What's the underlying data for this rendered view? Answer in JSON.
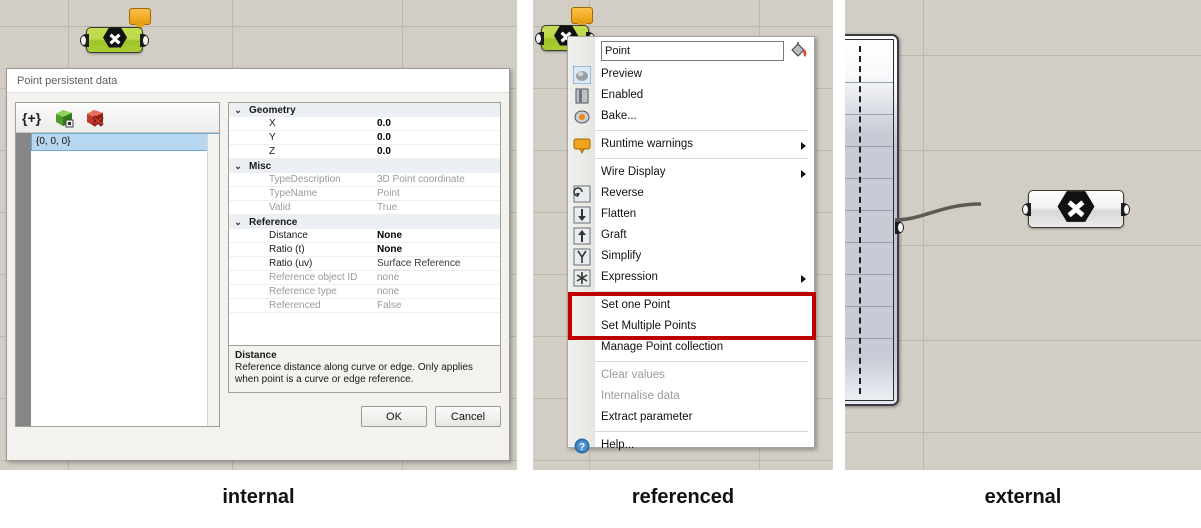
{
  "figure": {
    "captions": [
      {
        "key": "internal",
        "label": "internal"
      },
      {
        "key": "referenced",
        "label": "referenced"
      },
      {
        "key": "external",
        "label": "external"
      }
    ],
    "colors": {
      "canvas_background": "#d2cec5",
      "canvas_gridline": "#bcb8ae",
      "component_green": "#b9d646",
      "component_grey": "#ececec",
      "highlight_red": "#c00000",
      "selection_blue": "#b7d6ef",
      "balloon_orange": "#f2ab25"
    }
  },
  "panel_internal": {
    "component": {
      "name": "point-component",
      "icon": "hexagon-x-icon",
      "balloon": "warning-balloon-icon"
    },
    "dialog": {
      "title": "Point persistent data",
      "toolbar": [
        {
          "name": "insert-item-icon",
          "glyph": "{+}",
          "label": "{+}"
        },
        {
          "name": "add-green-box-icon",
          "glyph": "",
          "label": ""
        },
        {
          "name": "delete-red-box-icon",
          "glyph": "",
          "label": ""
        }
      ],
      "list": [
        {
          "index": "0",
          "value": "{0, 0, 0}"
        }
      ],
      "properties": [
        {
          "kind": "category",
          "name": "Geometry",
          "value": "",
          "chev": "⌄"
        },
        {
          "kind": "item",
          "name": "X",
          "value": "0.0",
          "style": "bold"
        },
        {
          "kind": "item",
          "name": "Y",
          "value": "0.0",
          "style": "bold"
        },
        {
          "kind": "item",
          "name": "Z",
          "value": "0.0",
          "style": "bold"
        },
        {
          "kind": "category",
          "name": "Misc",
          "value": "",
          "chev": "⌄"
        },
        {
          "kind": "item",
          "name": "TypeDescription",
          "value": "3D Point coordinate",
          "style": "dim"
        },
        {
          "kind": "item",
          "name": "TypeName",
          "value": "Point",
          "style": "dim"
        },
        {
          "kind": "item",
          "name": "Valid",
          "value": "True",
          "style": "dim"
        },
        {
          "kind": "category",
          "name": "Reference",
          "value": "",
          "chev": "⌄"
        },
        {
          "kind": "item",
          "name": "Distance",
          "value": "None",
          "style": "bold"
        },
        {
          "kind": "item",
          "name": "Ratio (t)",
          "value": "None",
          "style": "bold"
        },
        {
          "kind": "item",
          "name": "Ratio (uv)",
          "value": "Surface Reference",
          "style": "norm"
        },
        {
          "kind": "item",
          "name": "Reference object ID",
          "value": "none",
          "style": "dim"
        },
        {
          "kind": "item",
          "name": "Reference type",
          "value": "none",
          "style": "dim"
        },
        {
          "kind": "item",
          "name": "Referenced",
          "value": "False",
          "style": "dim"
        }
      ],
      "description": {
        "title": "Distance",
        "body": "Reference distance along curve or edge. Only applies when point is a curve or edge reference."
      },
      "buttons": [
        {
          "name": "ok-button",
          "label": "OK"
        },
        {
          "name": "cancel-button",
          "label": "Cancel"
        }
      ]
    }
  },
  "panel_referenced": {
    "component": {
      "name": "point-component",
      "icon": "hexagon-x-icon",
      "balloon": "warning-balloon-icon"
    },
    "menu": {
      "name_field": {
        "value": "Point",
        "placeholder": "Point"
      },
      "bucket_icon": "paint-bucket-icon",
      "items": [
        {
          "type": "item",
          "label": "Preview",
          "icon": "preview-sphere-icon",
          "enabled": true,
          "submenu": false
        },
        {
          "type": "item",
          "label": "Enabled",
          "icon": "enabled-switch-icon",
          "enabled": true,
          "submenu": false
        },
        {
          "type": "item",
          "label": "Bake...",
          "icon": "bake-icon",
          "enabled": true,
          "submenu": false
        },
        {
          "type": "sep"
        },
        {
          "type": "item",
          "label": "Runtime warnings",
          "icon": "warning-balloon-icon",
          "enabled": true,
          "submenu": true
        },
        {
          "type": "sep"
        },
        {
          "type": "item",
          "label": "Wire Display",
          "icon": "",
          "enabled": true,
          "submenu": true
        },
        {
          "type": "item",
          "label": "Reverse",
          "icon": "reverse-icon",
          "enabled": true,
          "submenu": false
        },
        {
          "type": "item",
          "label": "Flatten",
          "icon": "flatten-arrow-down-icon",
          "enabled": true,
          "submenu": false
        },
        {
          "type": "item",
          "label": "Graft",
          "icon": "graft-arrow-up-icon",
          "enabled": true,
          "submenu": false
        },
        {
          "type": "item",
          "label": "Simplify",
          "icon": "simplify-icon",
          "enabled": true,
          "submenu": false
        },
        {
          "type": "item",
          "label": "Expression",
          "icon": "expression-asterisk-icon",
          "enabled": true,
          "submenu": true
        },
        {
          "type": "sep"
        },
        {
          "type": "item",
          "label": "Set one Point",
          "icon": "",
          "enabled": true,
          "submenu": false,
          "highlighted": true
        },
        {
          "type": "item",
          "label": "Set Multiple Points",
          "icon": "",
          "enabled": true,
          "submenu": false,
          "highlighted": true
        },
        {
          "type": "item",
          "label": "Manage Point collection",
          "icon": "",
          "enabled": true,
          "submenu": false
        },
        {
          "type": "sep"
        },
        {
          "type": "item",
          "label": "Clear values",
          "icon": "",
          "enabled": false,
          "submenu": false
        },
        {
          "type": "item",
          "label": "Internalise data",
          "icon": "",
          "enabled": false,
          "submenu": false
        },
        {
          "type": "item",
          "label": "Extract parameter",
          "icon": "",
          "enabled": true,
          "submenu": false
        },
        {
          "type": "sep"
        },
        {
          "type": "item",
          "label": "Help...",
          "icon": "help-question-icon",
          "enabled": true,
          "submenu": false
        }
      ],
      "highlight_color": "#c00000"
    }
  },
  "panel_external": {
    "source_panel": {
      "name": "grasshopper-data-panel",
      "label": ""
    },
    "component": {
      "name": "point-component",
      "icon": "hexagon-x-icon"
    },
    "wire": {
      "name": "connection-wire",
      "color": "#5b5a55"
    }
  }
}
